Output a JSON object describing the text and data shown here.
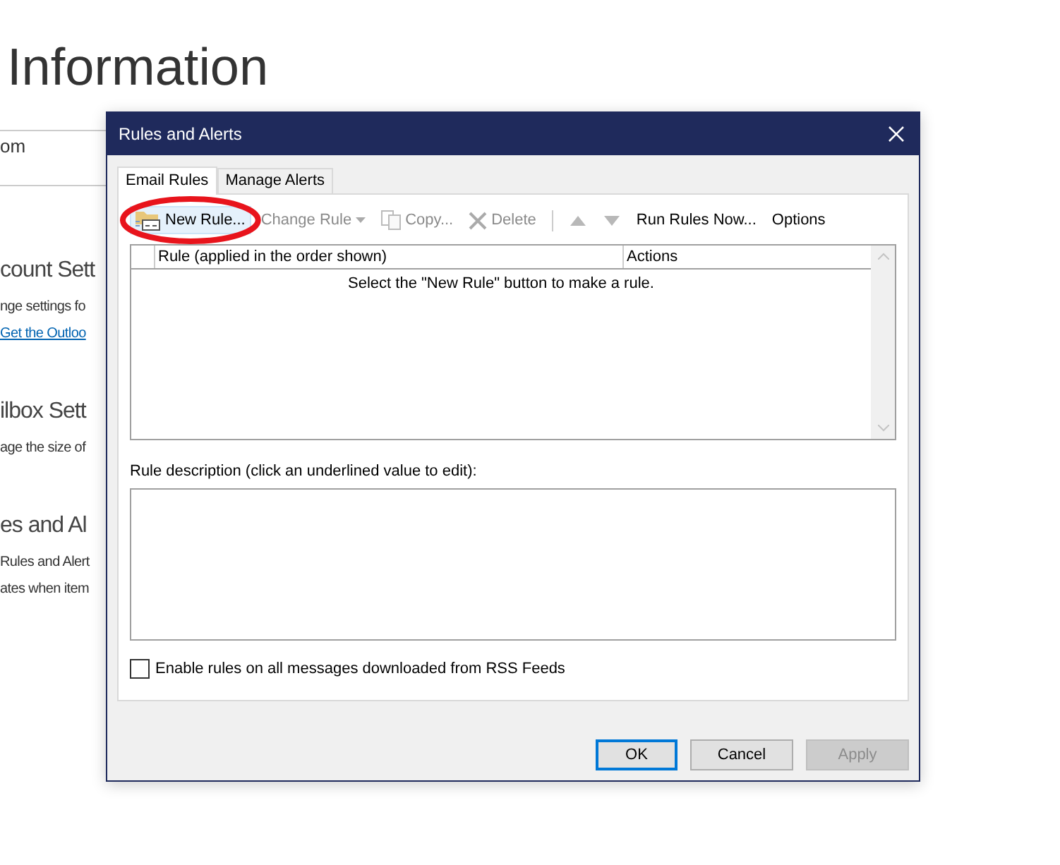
{
  "background": {
    "heading": "Information",
    "field_value": "om",
    "sections": [
      {
        "title": "count Sett",
        "lines": [
          {
            "text": "nge settings fo",
            "kind": "text"
          },
          {
            "text": "Get the Outloo",
            "kind": "link"
          }
        ]
      },
      {
        "title": "ilbox Sett",
        "lines": [
          {
            "text": "age the size of",
            "kind": "text"
          }
        ]
      },
      {
        "title": "es and Al",
        "lines": [
          {
            "text": "Rules and Alert",
            "kind": "text"
          },
          {
            "text": "ates when item",
            "kind": "text"
          }
        ]
      }
    ]
  },
  "dialog": {
    "title": "Rules and Alerts",
    "tabs": [
      {
        "label": "Email Rules",
        "selected": true
      },
      {
        "label": "Manage Alerts",
        "selected": false
      }
    ],
    "toolbar": [
      {
        "kind": "new",
        "label": "New Rule...",
        "disabled": false,
        "circled": true
      },
      {
        "kind": "dropdown",
        "label": "Change Rule",
        "disabled": true,
        "circled": false
      },
      {
        "kind": "copy",
        "label": "Copy...",
        "disabled": true,
        "circled": false
      },
      {
        "kind": "delete",
        "label": "Delete",
        "disabled": true,
        "circled": false
      },
      {
        "kind": "separator"
      },
      {
        "kind": "up",
        "disabled": true
      },
      {
        "kind": "down",
        "disabled": true
      },
      {
        "kind": "text",
        "label": "Run Rules Now...",
        "disabled": false,
        "circled": false
      },
      {
        "kind": "text",
        "label": "Options",
        "disabled": false,
        "circled": false
      }
    ],
    "rules_table": {
      "columns": [
        "Rule (applied in the order shown)",
        "Actions"
      ],
      "empty_message": "Select the \"New Rule\" button to make a rule."
    },
    "description_label": "Rule description (click an underlined value to edit):",
    "rss_checkbox": {
      "label": "Enable rules on all messages downloaded from RSS Feeds",
      "checked": false
    },
    "buttons": [
      {
        "label": "OK",
        "default": true,
        "disabled": false
      },
      {
        "label": "Cancel",
        "default": false,
        "disabled": false
      },
      {
        "label": "Apply",
        "default": false,
        "disabled": true
      }
    ]
  }
}
